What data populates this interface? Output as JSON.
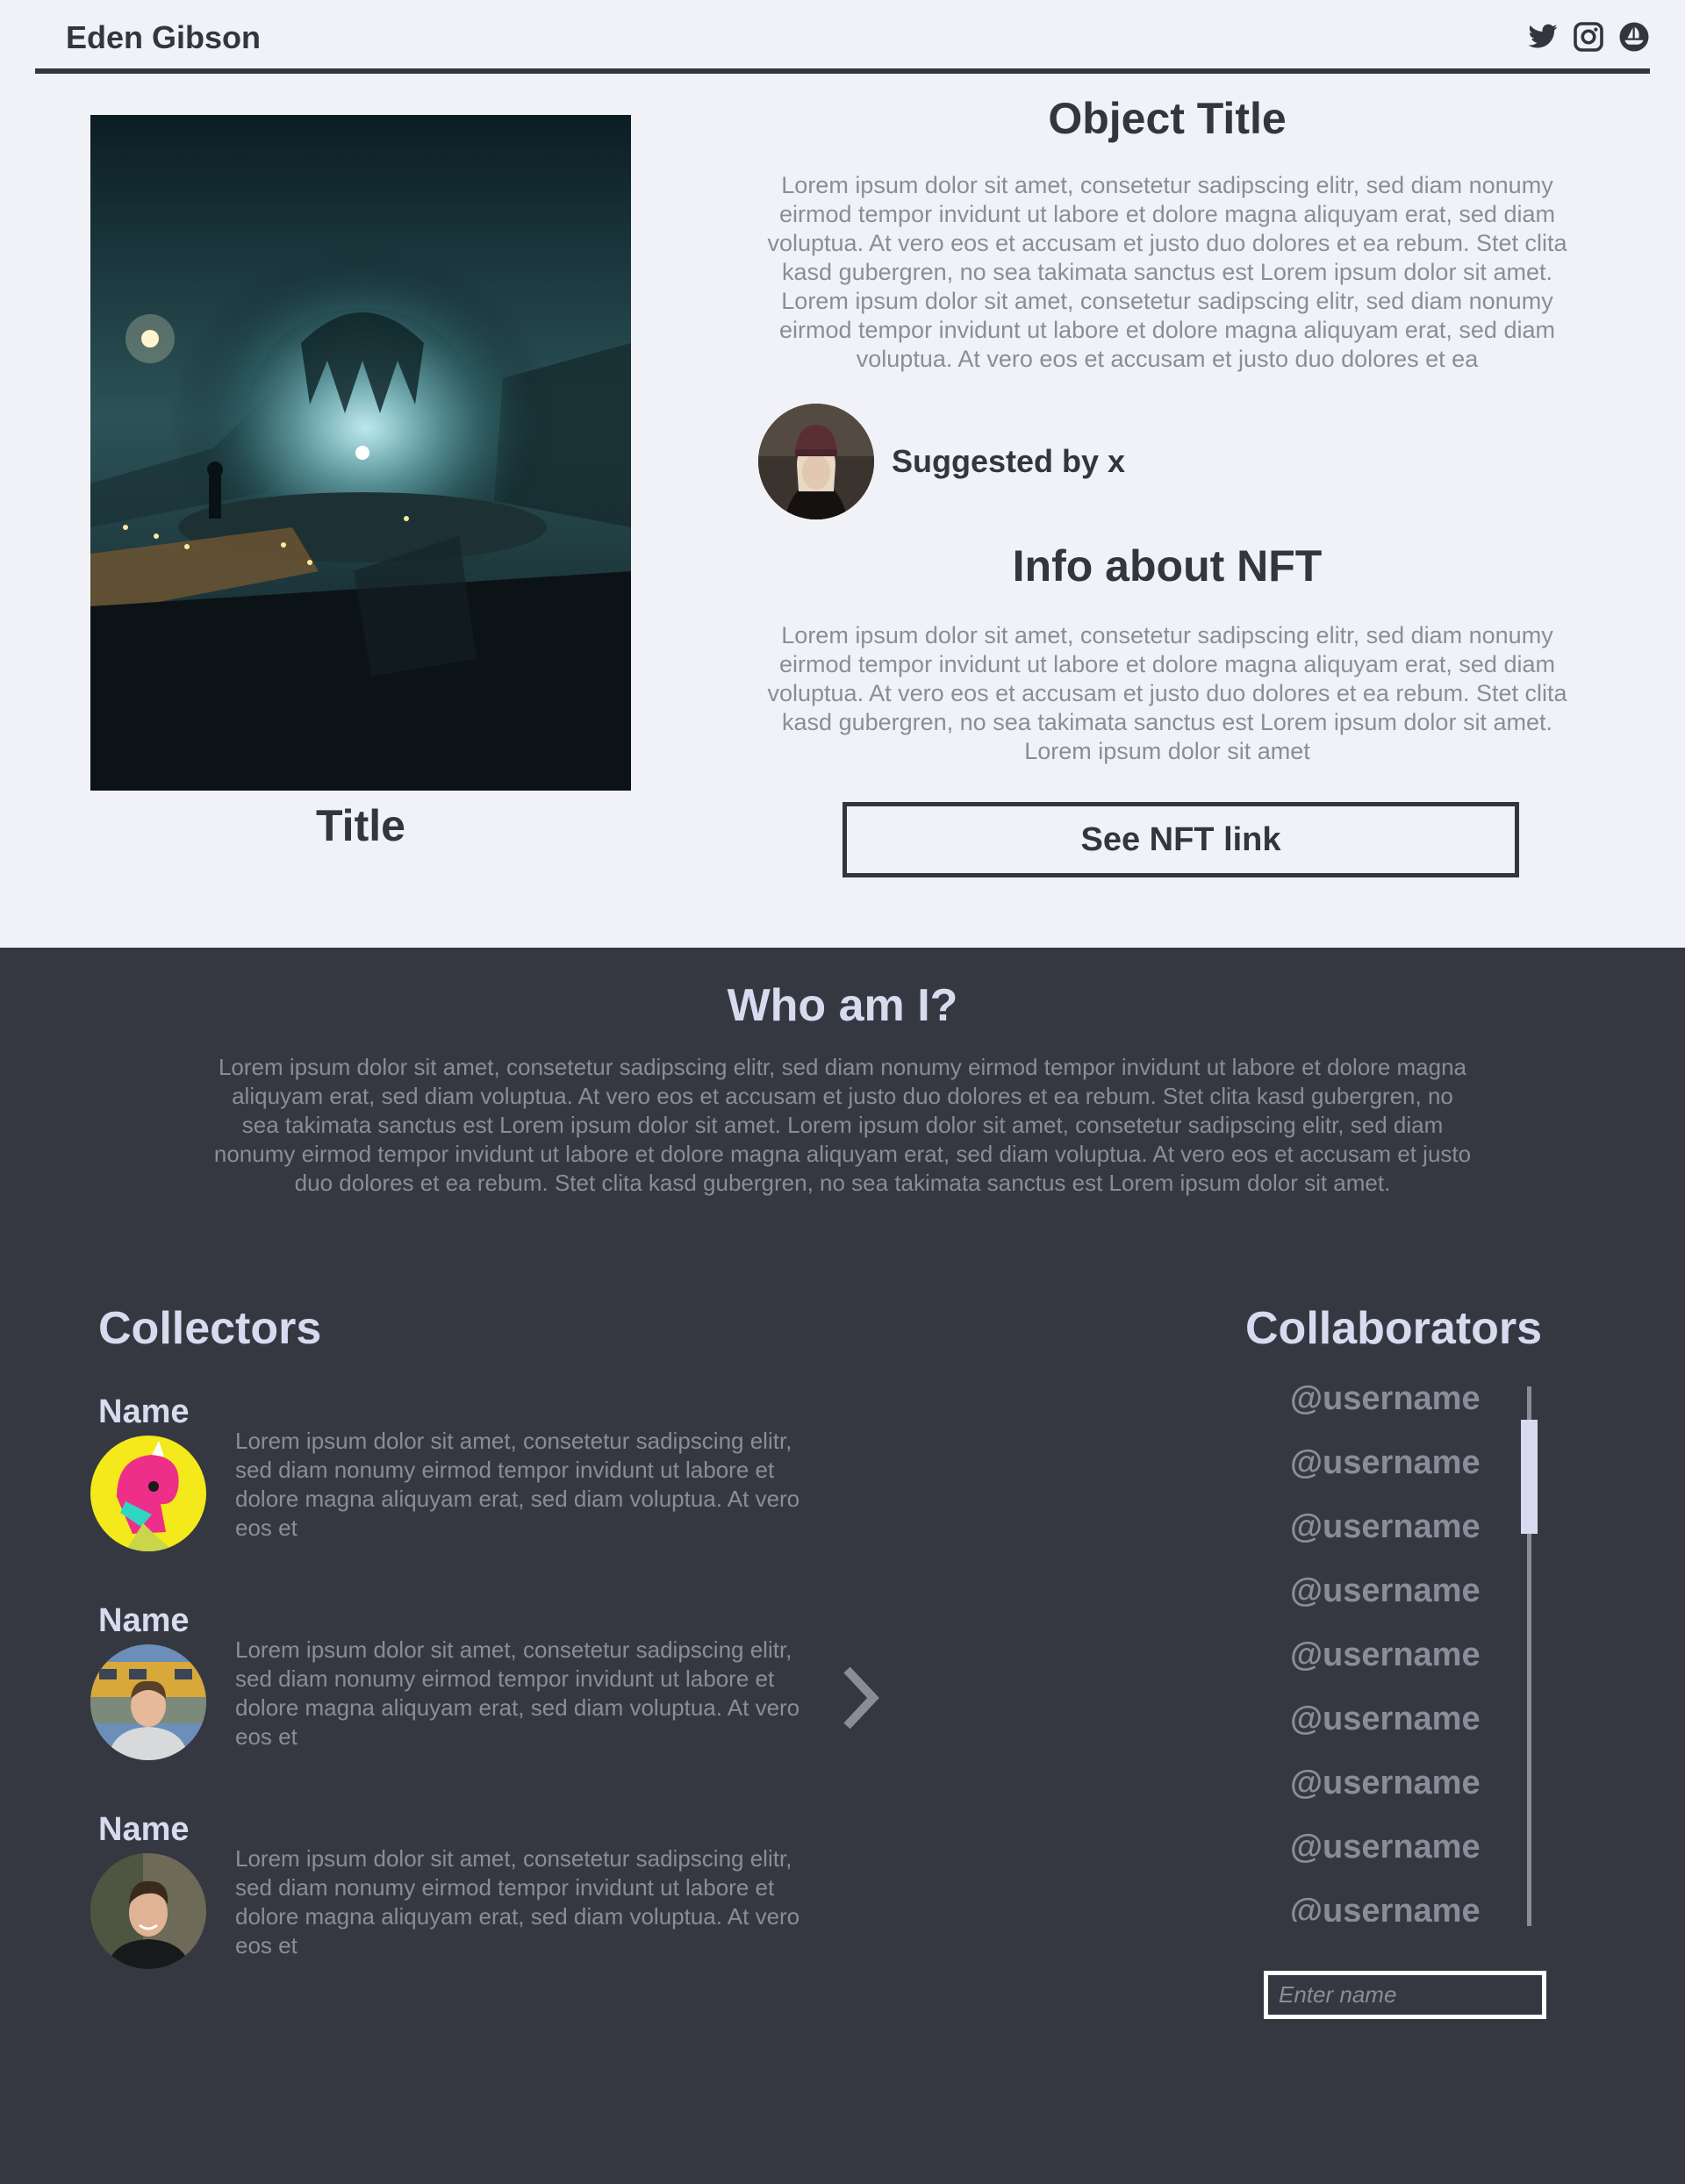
{
  "header": {
    "brand": "Eden Gibson",
    "socials": [
      "twitter-icon",
      "instagram-icon",
      "opensea-icon"
    ]
  },
  "artwork": {
    "title": "Title"
  },
  "object": {
    "title": "Object Title",
    "description": "Lorem ipsum dolor sit amet, consetetur sadipscing elitr, sed diam nonumy eirmod tempor invidunt ut labore et dolore magna aliquyam erat, sed diam voluptua. At vero eos et accusam et justo duo dolores et ea rebum. Stet clita kasd gubergren, no sea takimata sanctus est Lorem ipsum dolor sit amet. Lorem ipsum dolor sit amet, consetetur sadipscing elitr, sed diam nonumy eirmod tempor invidunt ut labore et dolore magna aliquyam erat, sed diam voluptua. At vero eos et accusam et justo duo dolores et ea"
  },
  "suggested": {
    "label": "Suggested by x"
  },
  "nft_info": {
    "title": "Info about NFT",
    "description": "Lorem ipsum dolor sit amet, consetetur sadipscing elitr, sed diam nonumy eirmod tempor invidunt ut labore et dolore magna aliquyam erat, sed diam voluptua. At vero eos et accusam et justo duo dolores et ea rebum. Stet clita kasd gubergren, no sea takimata sanctus est Lorem ipsum dolor sit amet. Lorem ipsum dolor sit amet",
    "button_label": "See NFT link"
  },
  "about": {
    "title": "Who am I?",
    "description": "Lorem ipsum dolor sit amet, consetetur sadipscing elitr, sed diam nonumy eirmod tempor invidunt ut labore et dolore magna aliquyam erat, sed diam voluptua. At vero eos et accusam et justo duo dolores et ea rebum. Stet clita kasd gubergren, no sea takimata sanctus est Lorem ipsum dolor sit amet. Lorem ipsum dolor sit amet, consetetur sadipscing elitr, sed diam nonumy eirmod tempor invidunt ut labore et dolore magna aliquyam erat, sed diam voluptua. At vero eos et accusam et justo duo dolores et ea rebum. Stet clita kasd gubergren, no sea takimata sanctus est Lorem ipsum dolor sit amet."
  },
  "collectors": {
    "title": "Collectors",
    "items": [
      {
        "name": "Name",
        "description": "Lorem ipsum dolor sit amet, consetetur sadipscing elitr, sed diam nonumy eirmod tempor invidunt ut labore et dolore magna aliquyam erat, sed diam voluptua. At vero eos et"
      },
      {
        "name": "Name",
        "description": "Lorem ipsum dolor sit amet, consetetur sadipscing elitr, sed diam nonumy eirmod tempor invidunt ut labore et dolore magna aliquyam erat, sed diam voluptua. At vero eos et"
      },
      {
        "name": "Name",
        "description": "Lorem ipsum dolor sit amet, consetetur sadipscing elitr, sed diam nonumy eirmod tempor invidunt ut labore et dolore magna aliquyam erat, sed diam voluptua. At vero eos et"
      }
    ]
  },
  "collaborators": {
    "title": "Collaborators",
    "items": [
      "@username",
      "@username",
      "@username",
      "@username",
      "@username",
      "@username",
      "@username",
      "@username",
      "@username"
    ],
    "input_placeholder": "Enter name"
  },
  "colors": {
    "light_bg": "#f1f2f7",
    "dark_bg": "#363841",
    "text_dark": "#33353f",
    "text_muted": "#8a8d99",
    "heading_light": "#d6dbef"
  }
}
